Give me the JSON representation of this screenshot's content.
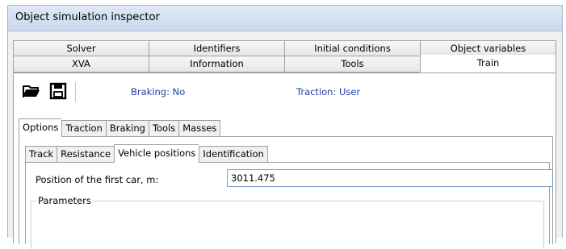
{
  "window": {
    "title": "Object simulation inspector"
  },
  "tabs_row1": [
    "Solver",
    "Identifiers",
    "Initial conditions",
    "Object variables"
  ],
  "tabs_row2": [
    "XVA",
    "Information",
    "Tools",
    "Train"
  ],
  "active_tab": "Train",
  "toolbar": {
    "open_icon": "folder-open-icon",
    "save_icon": "save-disk-icon",
    "braking_status": "Braking: No",
    "traction_status": "Traction: User",
    "status_color": "#1f3fa8"
  },
  "subtabs_row1": [
    "Options",
    "Traction",
    "Braking",
    "Tools",
    "Masses"
  ],
  "active_subtab_row1": "Options",
  "subtabs_row2": [
    "Track",
    "Resistance",
    "Vehicle positions",
    "Identification"
  ],
  "active_subtab_row2": "Vehicle positions",
  "vehicle_positions": {
    "first_car_label": "Position of the first car, m:",
    "first_car_value": "3011.475",
    "parameters_label": "Parameters"
  }
}
